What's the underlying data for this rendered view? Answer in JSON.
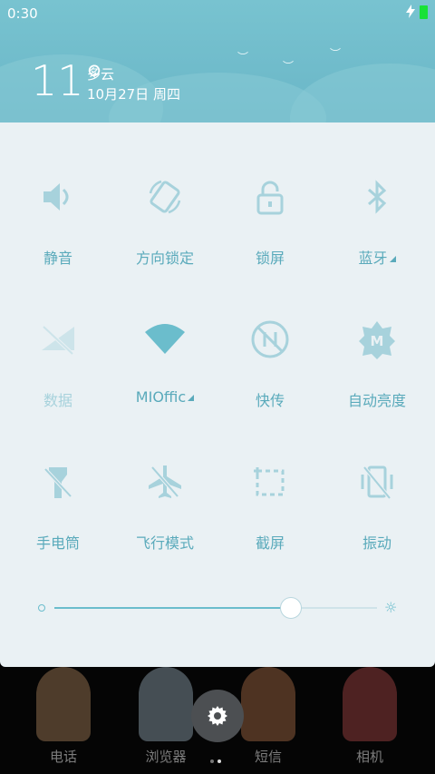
{
  "status_bar": {
    "time": "0:30",
    "charging_icon": "bolt-icon",
    "battery_color": "#18e238"
  },
  "weather": {
    "temperature": "11°",
    "condition": "多云",
    "date": "10月27日 周四"
  },
  "colors": {
    "accent": "#5aaabb",
    "panel_bg": "#eaf1f4",
    "header_bg": "#6ab6c7"
  },
  "tiles": [
    {
      "label": "静音",
      "icon": "volume-icon",
      "dim": false,
      "dropdown": false
    },
    {
      "label": "方向锁定",
      "icon": "rotation-lock-icon",
      "dim": false,
      "dropdown": false
    },
    {
      "label": "锁屏",
      "icon": "lock-icon",
      "dim": false,
      "dropdown": false
    },
    {
      "label": "蓝牙",
      "icon": "bluetooth-icon",
      "dim": false,
      "dropdown": true
    },
    {
      "label": "数据",
      "icon": "mobile-data-off-icon",
      "dim": true,
      "dropdown": false
    },
    {
      "label": "MIOffic",
      "icon": "wifi-icon",
      "dim": false,
      "dropdown": true
    },
    {
      "label": "快传",
      "icon": "quick-transfer-icon",
      "dim": false,
      "dropdown": false
    },
    {
      "label": "自动亮度",
      "icon": "auto-brightness-icon",
      "dim": false,
      "dropdown": false
    },
    {
      "label": "手电筒",
      "icon": "flashlight-icon",
      "dim": false,
      "dropdown": false
    },
    {
      "label": "飞行模式",
      "icon": "airplane-icon",
      "dim": false,
      "dropdown": false
    },
    {
      "label": "截屏",
      "icon": "screenshot-icon",
      "dim": false,
      "dropdown": false
    },
    {
      "label": "振动",
      "icon": "vibrate-icon",
      "dim": false,
      "dropdown": false
    }
  ],
  "brightness": {
    "level": 0.73
  },
  "dock": [
    {
      "label": "电话"
    },
    {
      "label": "浏览器"
    },
    {
      "label": "短信"
    },
    {
      "label": "相机"
    }
  ],
  "page_indicator": {
    "pages": 2,
    "current": 2
  }
}
